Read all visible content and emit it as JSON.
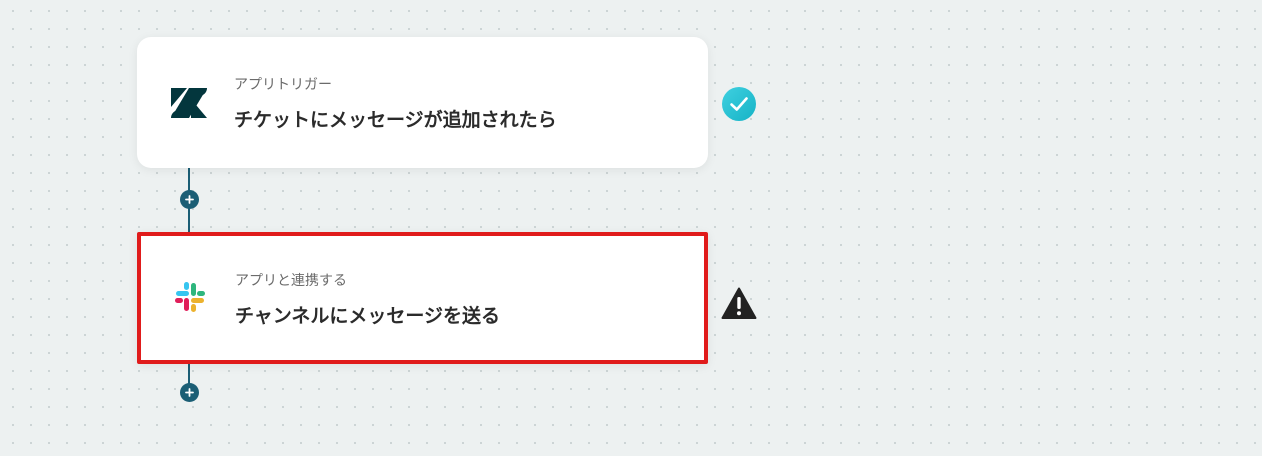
{
  "flow": {
    "trigger": {
      "label": "アプリトリガー",
      "title": "チケットにメッセージが追加されたら",
      "app_icon": "zendesk-logo",
      "status_icon": "check-circle-icon",
      "status_color": "#27c2d6"
    },
    "action": {
      "label": "アプリと連携する",
      "title": "チャンネルにメッセージを送る",
      "app_icon": "slack-logo",
      "status_icon": "warning-triangle-icon",
      "status_color": "#222222",
      "highlight_color": "#e01b1b"
    },
    "add_step_icon": "plus-icon",
    "connector_color": "#1b5e75"
  }
}
